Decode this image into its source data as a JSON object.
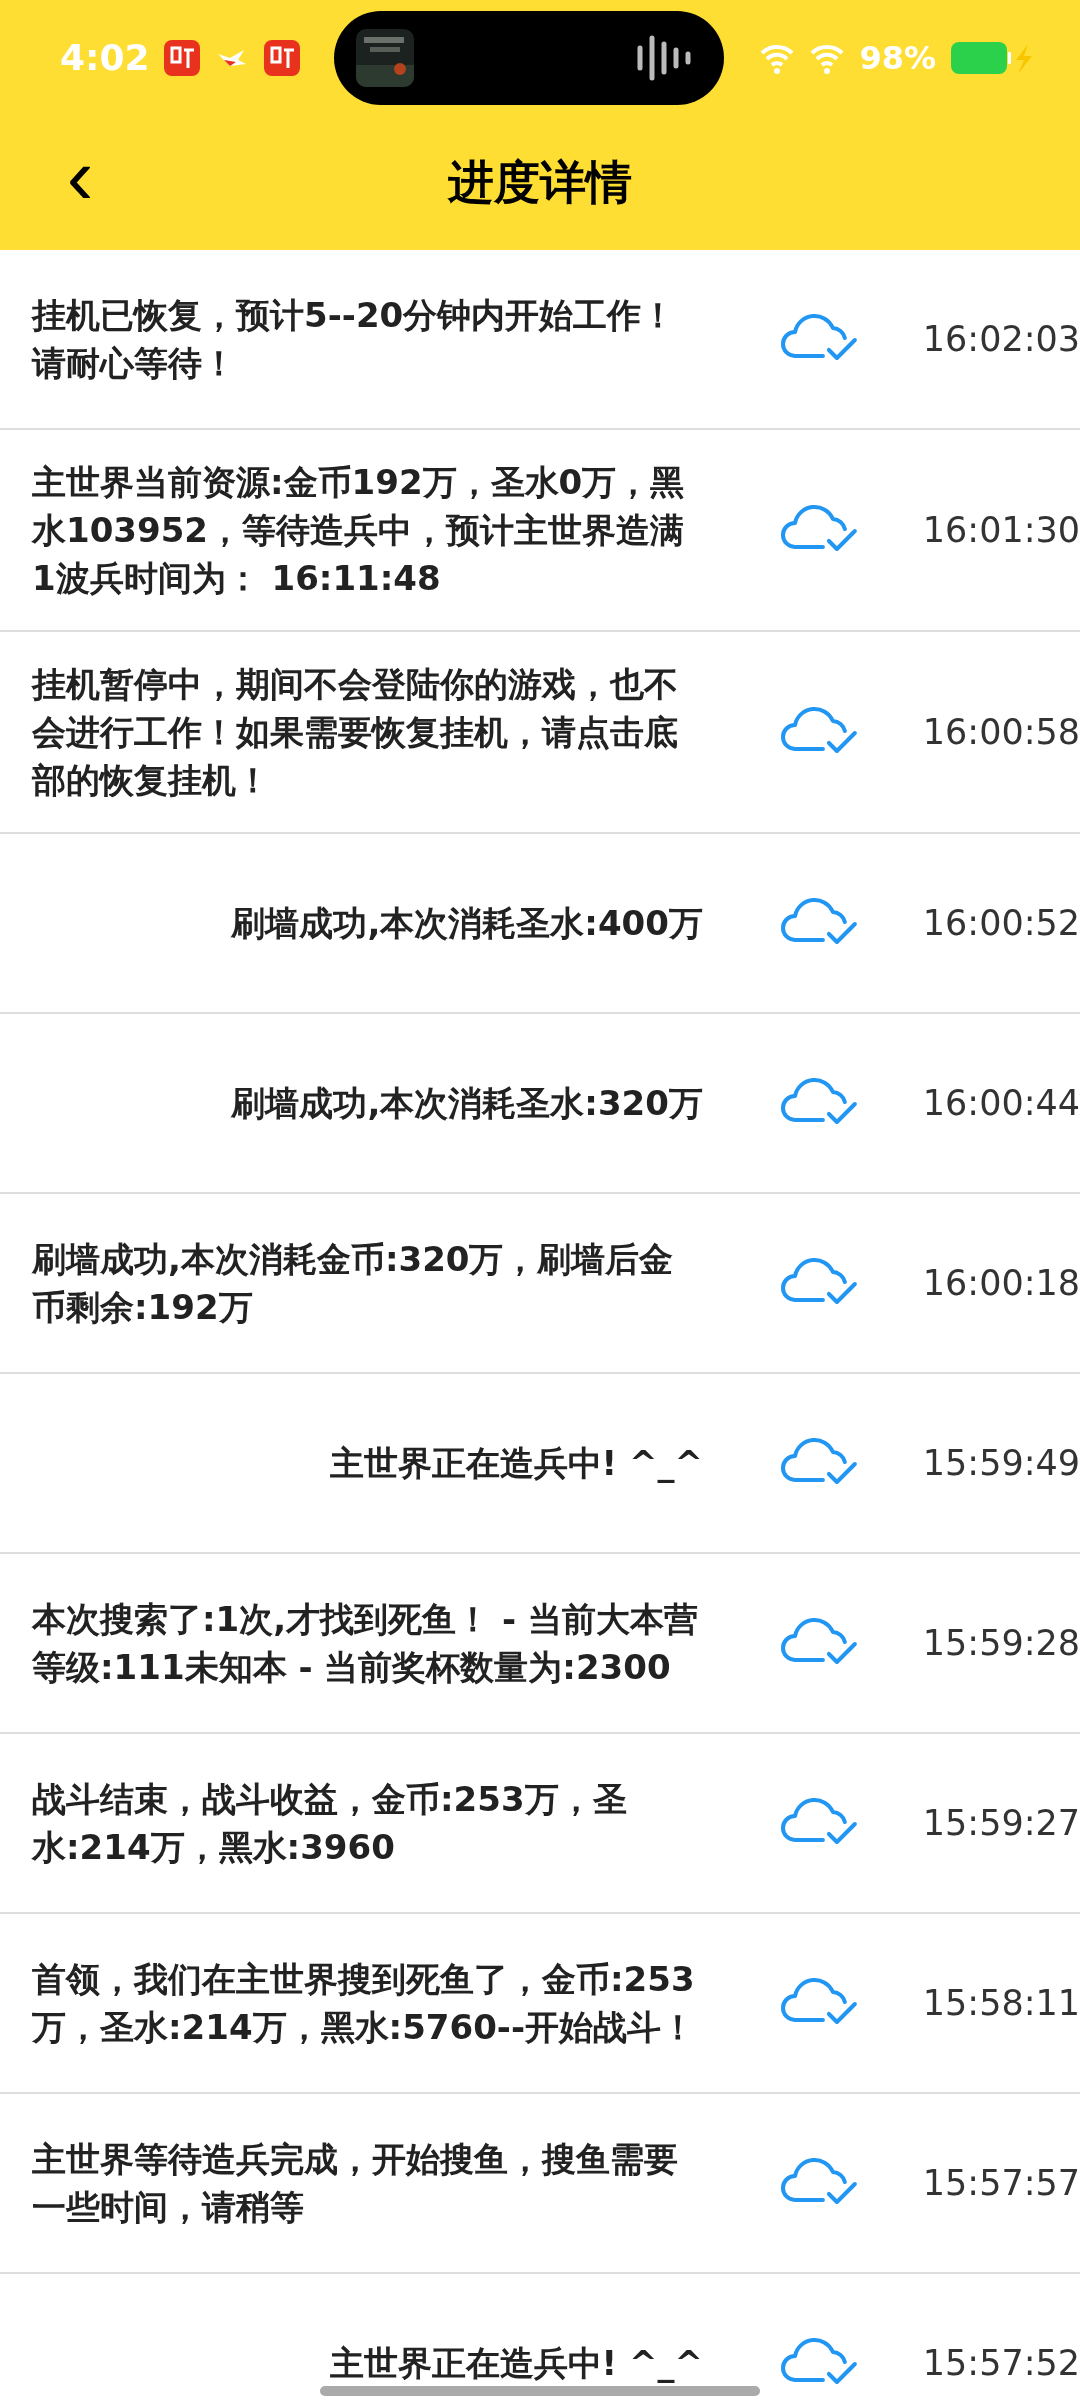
{
  "status_bar": {
    "time": "4:02",
    "battery": "98%"
  },
  "header": {
    "back": "‹",
    "title": "进度详情"
  },
  "rows": [
    {
      "text": "挂机已恢复，预计5--20分钟内开始工作！请耐心等待！",
      "time": "16:02:03"
    },
    {
      "text": "主世界当前资源:金币192万，圣水0万，黑水103952，等待造兵中，预计主世界造满1波兵时间为： 16:11:48",
      "time": "16:01:30"
    },
    {
      "text": "挂机暂停中，期间不会登陆你的游戏，也不会进行工作！如果需要恢复挂机，请点击底部的恢复挂机！",
      "time": "16:00:58"
    },
    {
      "text": "刷墙成功,本次消耗圣水:400万",
      "time": "16:00:52"
    },
    {
      "text": "刷墙成功,本次消耗圣水:320万",
      "time": "16:00:44"
    },
    {
      "text": "刷墙成功,本次消耗金币:320万，刷墙后金币剩余:192万",
      "time": "16:00:18"
    },
    {
      "text": "主世界正在造兵中! ^_^",
      "time": "15:59:49"
    },
    {
      "text": "本次搜索了:1次,才找到死鱼！ - 当前大本营等级:111未知本 - 当前奖杯数量为:2300",
      "time": "15:59:28"
    },
    {
      "text": "战斗结束，战斗收益，金币:253万，圣水:214万，黑水:3960",
      "time": "15:59:27"
    },
    {
      "text": "首领，我们在主世界搜到死鱼了，金币:253万，圣水:214万，黑水:5760--开始战斗！",
      "time": "15:58:11"
    },
    {
      "text": "主世界等待造兵完成，开始搜鱼，搜鱼需要一些时间，请稍等",
      "time": "15:57:57"
    },
    {
      "text": "主世界正在造兵中! ^_^",
      "time": "15:57:52"
    }
  ]
}
